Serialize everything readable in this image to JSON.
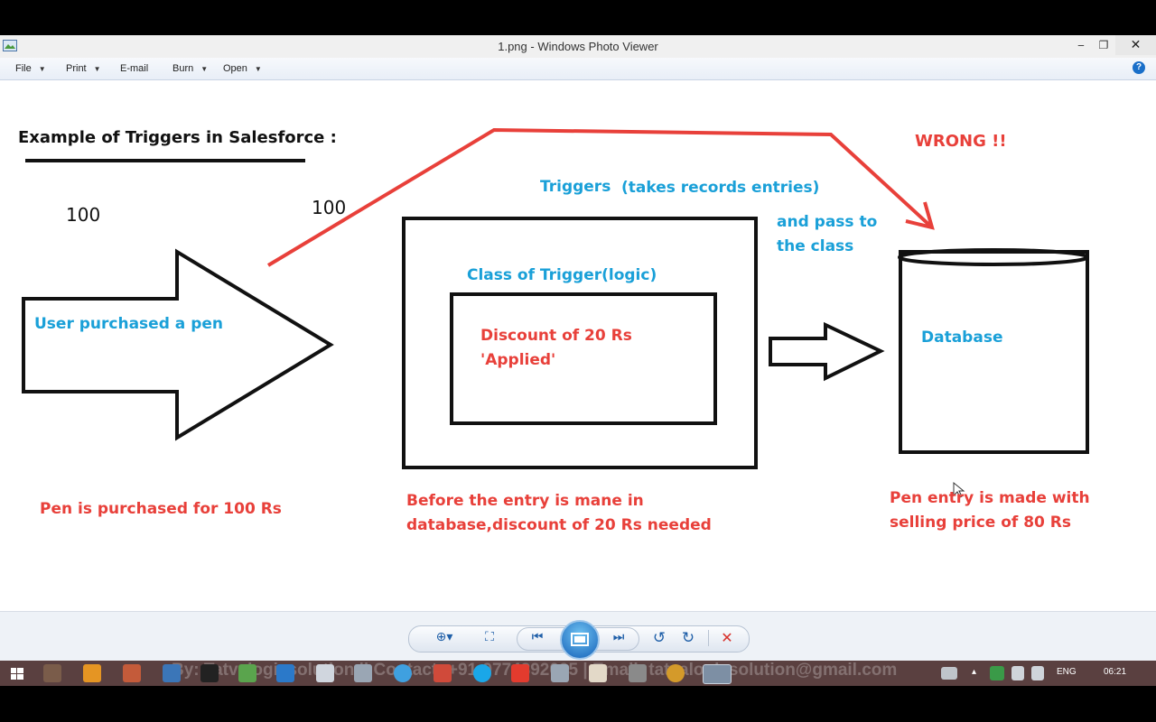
{
  "window": {
    "title": "1.png - Windows Photo Viewer",
    "minimize": "‒",
    "maximize": "❐",
    "close": "✕"
  },
  "menu": {
    "file": "File",
    "print": "Print",
    "email": "E-mail",
    "burn": "Burn",
    "open": "Open",
    "help": "?"
  },
  "slide": {
    "heading": "Example of Triggers in Salesforce :",
    "price_left": "100",
    "price_line": "100",
    "wrong": "WRONG !!",
    "triggers": "Triggers",
    "takes_entries": "(takes records entries)",
    "pass_line1": "and pass to",
    "pass_line2": "the class",
    "user_purchase": "User purchased a pen",
    "class_label": "Class of Trigger(logic)",
    "discount_line1": "Discount of 20 Rs",
    "discount_line2": "'Applied'",
    "database": "Database",
    "note_left": "Pen is purchased for 100 Rs",
    "note_mid_1": "Before the entry is mane in",
    "note_mid_2": "database,discount of 20 Rs needed",
    "note_right_1": "Pen entry is made with",
    "note_right_2": "selling price of 80 Rs"
  },
  "taskbar": {
    "watermark": "By: Tatvalogicsolution || Contact: +91-9774892005 | Email: tatvalogicsolution@gmail.com",
    "lang": "ENG",
    "time": "06:21"
  },
  "colors": {
    "blue": "#1aa0d8",
    "red": "#e8403a",
    "taskbar": "#5a4040"
  }
}
